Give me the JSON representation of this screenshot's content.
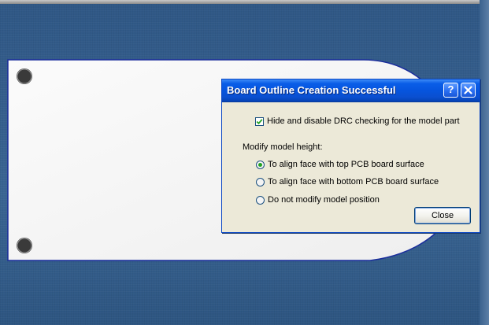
{
  "dialog": {
    "title": "Board Outline Creation Successful",
    "help_glyph": "?",
    "checkbox": {
      "label": "Hide and disable DRC checking for the model part",
      "checked": true
    },
    "group_label": "Modify model height:",
    "options": [
      {
        "label": "To align face with top PCB board surface",
        "selected": true
      },
      {
        "label": "To align face with bottom PCB board surface",
        "selected": false
      },
      {
        "label": "Do not modify model position",
        "selected": false
      }
    ],
    "close_label": "Close"
  },
  "colors": {
    "viewport_bg": "#2f5683",
    "board_fill": "#ffffff",
    "board_outline": "#1a2d9c",
    "titlebar": "#0655de",
    "dialog_bg": "#ece9d8",
    "radio_dot": "#21a121"
  },
  "icons": {
    "help": "help-icon",
    "close": "close-icon",
    "check": "checkmark-icon",
    "mounting_hole": "mounting-hole-icon"
  }
}
